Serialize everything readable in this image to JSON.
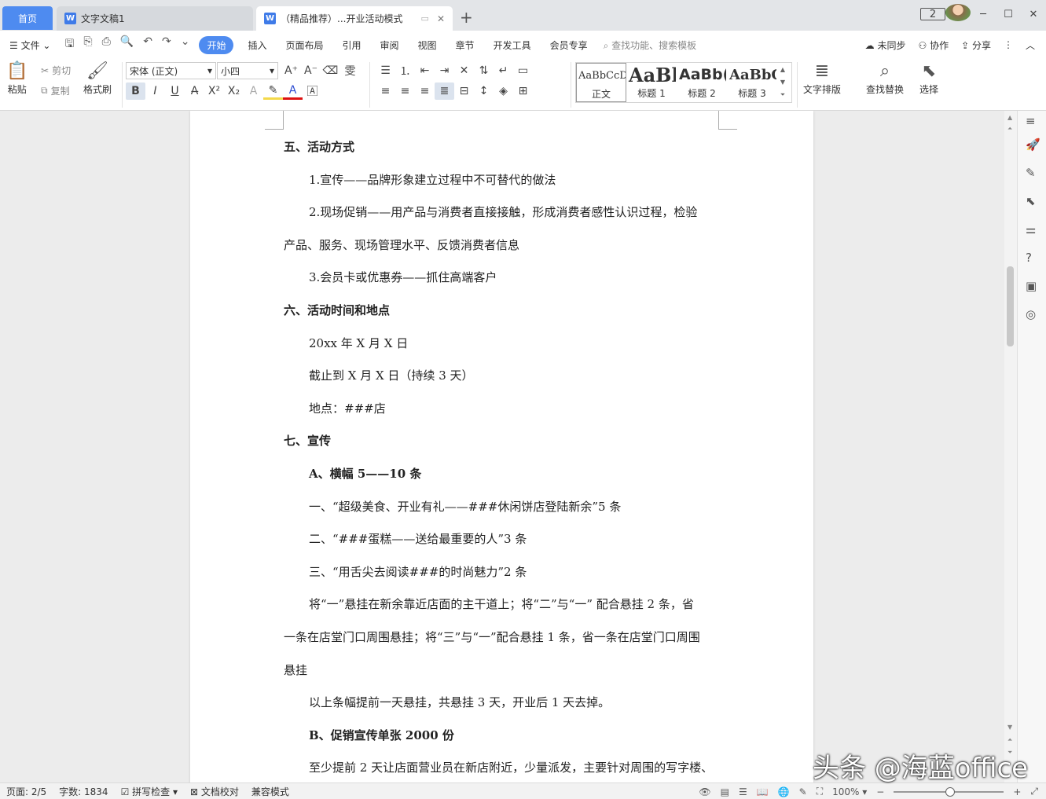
{
  "tabs": {
    "home": "首页",
    "doc1": "文字文稿1",
    "doc2": "（精品推荐）...开业活动模式"
  },
  "titlebar": {
    "badge": "2"
  },
  "menu": {
    "file": "文件",
    "items": [
      "开始",
      "插入",
      "页面布局",
      "引用",
      "审阅",
      "视图",
      "章节",
      "开发工具",
      "会员专享"
    ],
    "search": "查找功能、搜索模板",
    "unsynced": "未同步",
    "collaborate": "协作",
    "share": "分享"
  },
  "ribbon": {
    "paste": "粘贴",
    "cut": "剪切",
    "copy": "复制",
    "format_painter": "格式刷",
    "font_name": "宋体 (正文)",
    "font_size": "小四",
    "styles": [
      {
        "sample": "AaBbCcDd",
        "label": "正文"
      },
      {
        "sample": "AaBl",
        "label": "标题 1"
      },
      {
        "sample": "AaBb(",
        "label": "标题 2"
      },
      {
        "sample": "AaBbC",
        "label": "标题 3"
      }
    ],
    "text_layout": "文字排版",
    "find_replace": "查找替换",
    "select": "选择"
  },
  "document": {
    "lines": [
      {
        "text": "五、活动方式",
        "bold": true,
        "indent": false
      },
      {
        "text": "1.宣传——品牌形象建立过程中不可替代的做法",
        "bold": false,
        "indent": true
      },
      {
        "text": "2.现场促销——用产品与消费者直接接触，形成消费者感性认识过程，检验",
        "bold": false,
        "indent": true
      },
      {
        "text": "产品、服务、现场管理水平、反馈消费者信息",
        "bold": false,
        "indent": false
      },
      {
        "text": "3.会员卡或优惠券——抓住高端客户",
        "bold": false,
        "indent": true
      },
      {
        "text": "六、活动时间和地点",
        "bold": true,
        "indent": false
      },
      {
        "text": "20xx 年 X 月 X 日",
        "bold": false,
        "indent": true
      },
      {
        "text": "截止到 X 月 X 日（持续 3 天）",
        "bold": false,
        "indent": true
      },
      {
        "text": "地点：###店",
        "bold": false,
        "indent": true
      },
      {
        "text": "七、宣传",
        "bold": true,
        "indent": false
      },
      {
        "text": "A、横幅 5——10 条",
        "bold": true,
        "indent": true
      },
      {
        "text": "一、“超级美食、开业有礼——###休闲饼店登陆新余”5 条",
        "bold": false,
        "indent": true
      },
      {
        "text": "二、“###蛋糕——送给最重要的人”3 条",
        "bold": false,
        "indent": true
      },
      {
        "text": "三、“用舌尖去阅读###的时尚魅力”2 条",
        "bold": false,
        "indent": true
      },
      {
        "text": "将“一”悬挂在新余靠近店面的主干道上；将“二”与“一” 配合悬挂 2 条，省",
        "bold": false,
        "indent": true
      },
      {
        "text": "一条在店堂门口周围悬挂；将“三”与“一”配合悬挂 1 条，省一条在店堂门口周围",
        "bold": false,
        "indent": false
      },
      {
        "text": "悬挂",
        "bold": false,
        "indent": false
      },
      {
        "text": "以上条幅提前一天悬挂，共悬挂 3 天，开业后 1 天去掉。",
        "bold": false,
        "indent": true
      },
      {
        "text": "B、促销宣传单张 2000 份",
        "bold": true,
        "indent": true
      },
      {
        "text": "至少提前 2 天让店面营业员在新店附近，少量派发，主要针对周围的写字楼、",
        "bold": false,
        "indent": true
      }
    ]
  },
  "status": {
    "page": "页面: 2/5",
    "word_count": "字数: 1834",
    "spell_check": "拼写检查",
    "proofread": "文档校对",
    "compat_mode": "兼容模式",
    "zoom": "100%"
  },
  "watermark": "头条 @海蓝office"
}
